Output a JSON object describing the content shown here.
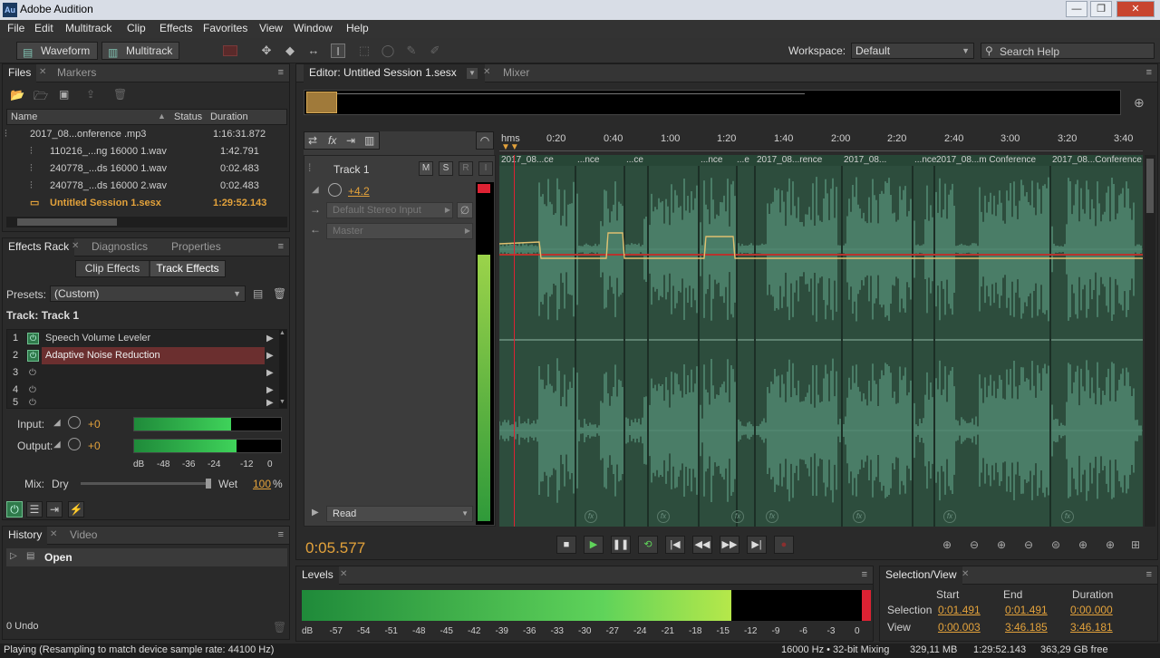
{
  "window": {
    "title": "Adobe Audition",
    "app_icon": "Au",
    "minimize": "—",
    "maximize": "❐",
    "close": "✕"
  },
  "menu": [
    "File",
    "Edit",
    "Multitrack",
    "Clip",
    "Effects",
    "Favorites",
    "View",
    "Window",
    "Help"
  ],
  "toolbar": {
    "waveform": "Waveform",
    "multitrack": "Multitrack",
    "workspace_label": "Workspace:",
    "workspace_value": "Default",
    "search_placeholder": "Search Help"
  },
  "files": {
    "tabs": [
      "Files",
      "Markers"
    ],
    "columns": [
      "Name",
      "Status",
      "Duration"
    ],
    "rows": [
      {
        "name": "2017_08...onference .mp3",
        "duration": "1:16:31.872"
      },
      {
        "name": "110216_...ng 16000 1.wav",
        "duration": "1:42.791"
      },
      {
        "name": "240778_...ds 16000 1.wav",
        "duration": "0:02.483"
      },
      {
        "name": "240778_...ds 16000 2.wav",
        "duration": "0:02.483"
      },
      {
        "name": "Untitled Session 1.sesx",
        "duration": "1:29:52.143"
      }
    ]
  },
  "effects": {
    "tabs": [
      "Effects Rack",
      "Diagnostics",
      "Properties"
    ],
    "clip_effects": "Clip Effects",
    "track_effects": "Track Effects",
    "presets_label": "Presets:",
    "presets_value": "(Custom)",
    "track_label": "Track: Track 1",
    "slots": [
      {
        "n": "1",
        "name": "Speech Volume Leveler"
      },
      {
        "n": "2",
        "name": "Adaptive Noise Reduction"
      },
      {
        "n": "3",
        "name": ""
      },
      {
        "n": "4",
        "name": ""
      },
      {
        "n": "5",
        "name": ""
      }
    ],
    "input_label": "Input:",
    "input_value": "+0",
    "output_label": "Output:",
    "output_value": "+0",
    "input_level": 0.66,
    "output_level": 0.7,
    "meter_ticks": [
      "dB",
      "-48",
      "-36",
      "-24",
      "-12",
      "0"
    ],
    "mix_label": "Mix:",
    "dry": "Dry",
    "wet": "Wet",
    "wet_value": "100",
    "percent": "%"
  },
  "history": {
    "tabs": [
      "History",
      "Video"
    ],
    "item": "Open",
    "undo": "0 Undo"
  },
  "editor": {
    "tab_label": "Editor: Untitled Session 1.sesx",
    "mixer_tab": "Mixer",
    "track_name": "Track 1",
    "m": "M",
    "s": "S",
    "r": "R",
    "i": "I",
    "volume": "+4.2",
    "input": "Default Stereo Input",
    "output": "Master",
    "automation": "Read",
    "ruler_start": "hms",
    "ruler": [
      "0:20",
      "0:40",
      "1:00",
      "1:20",
      "1:40",
      "2:00",
      "2:20",
      "2:40",
      "3:00",
      "3:20",
      "3:40"
    ],
    "clips": [
      "2017_08...ce",
      "...nce",
      "...ce",
      "...nce",
      "...e",
      "2017_08...rence",
      "2017_08...",
      "...nce",
      "2017_08...m Conference",
      "2017_08...Conference"
    ],
    "fx": "fx",
    "time": "0:05.577"
  },
  "levels": {
    "title": "Levels",
    "ticks": [
      "dB",
      "-57",
      "-54",
      "-51",
      "-48",
      "-45",
      "-42",
      "-39",
      "-36",
      "-33",
      "-30",
      "-27",
      "-24",
      "-21",
      "-18",
      "-15",
      "-12",
      "-9",
      "-6",
      "-3",
      "0"
    ],
    "level": 0.755
  },
  "selection": {
    "title": "Selection/View",
    "cols": [
      "Start",
      "End",
      "Duration"
    ],
    "selection_label": "Selection",
    "view_label": "View",
    "selection": [
      "0:01.491",
      "0:01.491",
      "0:00.000"
    ],
    "view": [
      "0:00.003",
      "3:46.185",
      "3:46.181"
    ]
  },
  "status": {
    "left": "Playing (Resampling to match device sample rate: 44100 Hz)",
    "rate": "16000 Hz • 32-bit Mixing",
    "mem": "329,11 MB",
    "dur": "1:29:52.143",
    "free": "363,29 GB free"
  }
}
